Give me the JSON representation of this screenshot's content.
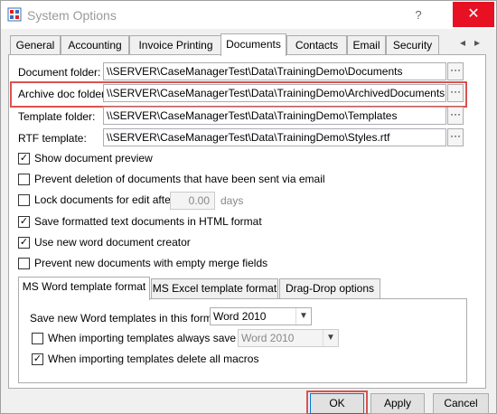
{
  "window": {
    "title": "System Options"
  },
  "titlebar": {
    "help_label": "?",
    "close_label": "✕"
  },
  "tabs": [
    {
      "label": "General"
    },
    {
      "label": "Accounting"
    },
    {
      "label": "Invoice Printing"
    },
    {
      "label": "Documents"
    },
    {
      "label": "Contacts"
    },
    {
      "label": "Email"
    },
    {
      "label": "Security"
    }
  ],
  "tab_scroll": {
    "left": "◂",
    "right": "▸"
  },
  "active_tab": "Documents",
  "folders": {
    "document_folder": {
      "label": "Document folder:",
      "value": "\\\\SERVER\\CaseManagerTest\\Data\\TrainingDemo\\Documents"
    },
    "archive_folder": {
      "label": "Archive doc folder:",
      "value": "\\\\SERVER\\CaseManagerTest\\Data\\TrainingDemo\\ArchivedDocuments"
    },
    "template_folder": {
      "label": "Template folder:",
      "value": "\\\\SERVER\\CaseManagerTest\\Data\\TrainingDemo\\Templates"
    },
    "rtf_template": {
      "label": "RTF template:",
      "value": "\\\\SERVER\\CaseManagerTest\\Data\\TrainingDemo\\Styles.rtf"
    },
    "browse_label": "···"
  },
  "options": {
    "show_preview": {
      "label": "Show document preview",
      "checked": true
    },
    "prevent_deletion": {
      "label": "Prevent deletion of documents that have been sent via email",
      "checked": false
    },
    "lock_documents": {
      "label": "Lock documents for edit after",
      "checked": false,
      "days_value": "0.00",
      "days_label": "days"
    },
    "save_html": {
      "label": "Save formatted text documents in HTML format",
      "checked": true
    },
    "new_word_creator": {
      "label": "Use new word document creator",
      "checked": true
    },
    "prevent_empty_merge": {
      "label": "Prevent new documents with empty merge fields",
      "checked": false
    }
  },
  "inner_tabs": [
    {
      "label": "MS Word template format"
    },
    {
      "label": "MS Excel template format"
    },
    {
      "label": "Drag-Drop options"
    }
  ],
  "word_format": {
    "save_label": "Save new Word templates in this format:",
    "save_value": "Word 2010",
    "always_save_label": "When importing templates always save as:",
    "always_save_checked": false,
    "always_save_value": "Word 2010",
    "delete_macros_label": "When importing templates delete all macros",
    "delete_macros_checked": true
  },
  "buttons": {
    "ok": "OK",
    "apply": "Apply",
    "cancel": "Cancel"
  },
  "colors": {
    "highlight": "#d9534f",
    "close": "#e81123"
  }
}
